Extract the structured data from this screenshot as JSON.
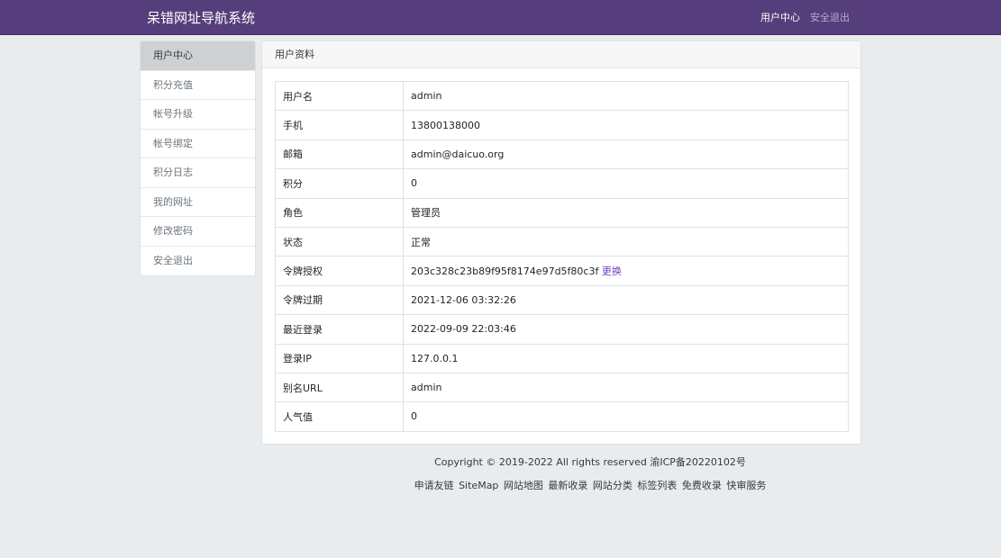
{
  "header": {
    "brand": "呆错网址导航系统",
    "nav": [
      {
        "label": "用户中心"
      },
      {
        "label": "安全退出"
      }
    ]
  },
  "sidebar": {
    "items": [
      {
        "label": "用户中心"
      },
      {
        "label": "积分充值"
      },
      {
        "label": "帐号升级"
      },
      {
        "label": "帐号绑定"
      },
      {
        "label": "积分日志"
      },
      {
        "label": "我的网址"
      },
      {
        "label": "修改密码"
      },
      {
        "label": "安全退出"
      }
    ]
  },
  "profile": {
    "title": "用户资料",
    "rows": [
      {
        "key": "用户名",
        "value": "admin"
      },
      {
        "key": "手机",
        "value": "13800138000"
      },
      {
        "key": "邮箱",
        "value": "admin@daicuo.org"
      },
      {
        "key": "积分",
        "value": "0"
      },
      {
        "key": "角色",
        "value": "管理员"
      },
      {
        "key": "状态",
        "value": "正常"
      },
      {
        "key": "令牌授权",
        "value": "203c328c23b89f95f8174e97d5f80c3f",
        "action": "更换"
      },
      {
        "key": "令牌过期",
        "value": "2021-12-06 03:32:26"
      },
      {
        "key": "最近登录",
        "value": "2022-09-09 22:03:46"
      },
      {
        "key": "登录IP",
        "value": "127.0.0.1"
      },
      {
        "key": "别名URL",
        "value": "admin"
      },
      {
        "key": "人气值",
        "value": "0"
      }
    ]
  },
  "footer": {
    "copyright": "Copyright © 2019-2022 All rights reserved 渝ICP备20220102号",
    "links": [
      {
        "label": "申请友链"
      },
      {
        "label": "SiteMap"
      },
      {
        "label": "网站地图"
      },
      {
        "label": "最新收录"
      },
      {
        "label": "网站分类"
      },
      {
        "label": "标签列表"
      },
      {
        "label": "免费收录"
      },
      {
        "label": "快审服务"
      }
    ]
  }
}
